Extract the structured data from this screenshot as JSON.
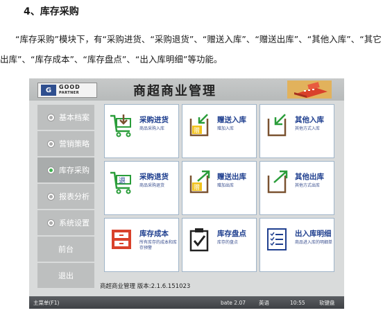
{
  "doc": {
    "heading": "4、库存采购",
    "paragraph": "“库存采购”模块下，有“采购进货、“采购退货”、“赠送入库”、“赠送出库”、“其他入库”、“其它出库”、“库存成本”、“库存盘点”、“出入库明细”等功能。"
  },
  "app": {
    "title": "商超商业管理",
    "logo_mark": "G",
    "logo_word": "GOOD",
    "logo_sub": "PARTNER",
    "sidebar": [
      {
        "label": "基本档案",
        "radio": true,
        "active": false
      },
      {
        "label": "营销策略",
        "radio": true,
        "active": false
      },
      {
        "label": "库存采购",
        "radio": true,
        "active": true
      },
      {
        "label": "报表分析",
        "radio": true,
        "active": false
      },
      {
        "label": "系统设置",
        "radio": true,
        "active": false
      },
      {
        "label": "前台",
        "radio": false,
        "active": false
      },
      {
        "label": "退出",
        "radio": false,
        "active": false
      }
    ],
    "tiles": [
      {
        "title": "采购进货",
        "subtitle": "商品采购入库",
        "icon": "cart-in-icon"
      },
      {
        "title": "赠送入库",
        "subtitle": "赠加入库",
        "icon": "gift-in-icon"
      },
      {
        "title": "其他入库",
        "subtitle": "其他方式入库",
        "icon": "box-in-icon"
      },
      {
        "title": "采购退货",
        "subtitle": "商品采购退货",
        "icon": "cart-return-icon"
      },
      {
        "title": "赠送出库",
        "subtitle": "赠加出库",
        "icon": "gift-out-icon"
      },
      {
        "title": "其他出库",
        "subtitle": "其他方式出库",
        "icon": "box-out-icon"
      },
      {
        "title": "库存成本",
        "subtitle": "所有库存的成本和库存预警",
        "icon": "cabinet-icon"
      },
      {
        "title": "库存盘点",
        "subtitle": "库存的盘点",
        "icon": "clipboard-check-icon"
      },
      {
        "title": "出入库明细",
        "subtitle": "商品进入库的明细单",
        "icon": "list-detail-icon"
      }
    ],
    "version_text": "商超商业管理  版本:2.1.6.151023",
    "status": {
      "menu": "主菜单(F1)",
      "build": "bate 2.07",
      "lang": "英语",
      "time": "10:55",
      "keyboard": "软键盘"
    },
    "colors": {
      "accent_green": "#2a9d3a",
      "tile_title": "#1f3f8f",
      "brown": "#7a5230",
      "red": "#d9412b",
      "yellow": "#f2c21b"
    }
  }
}
